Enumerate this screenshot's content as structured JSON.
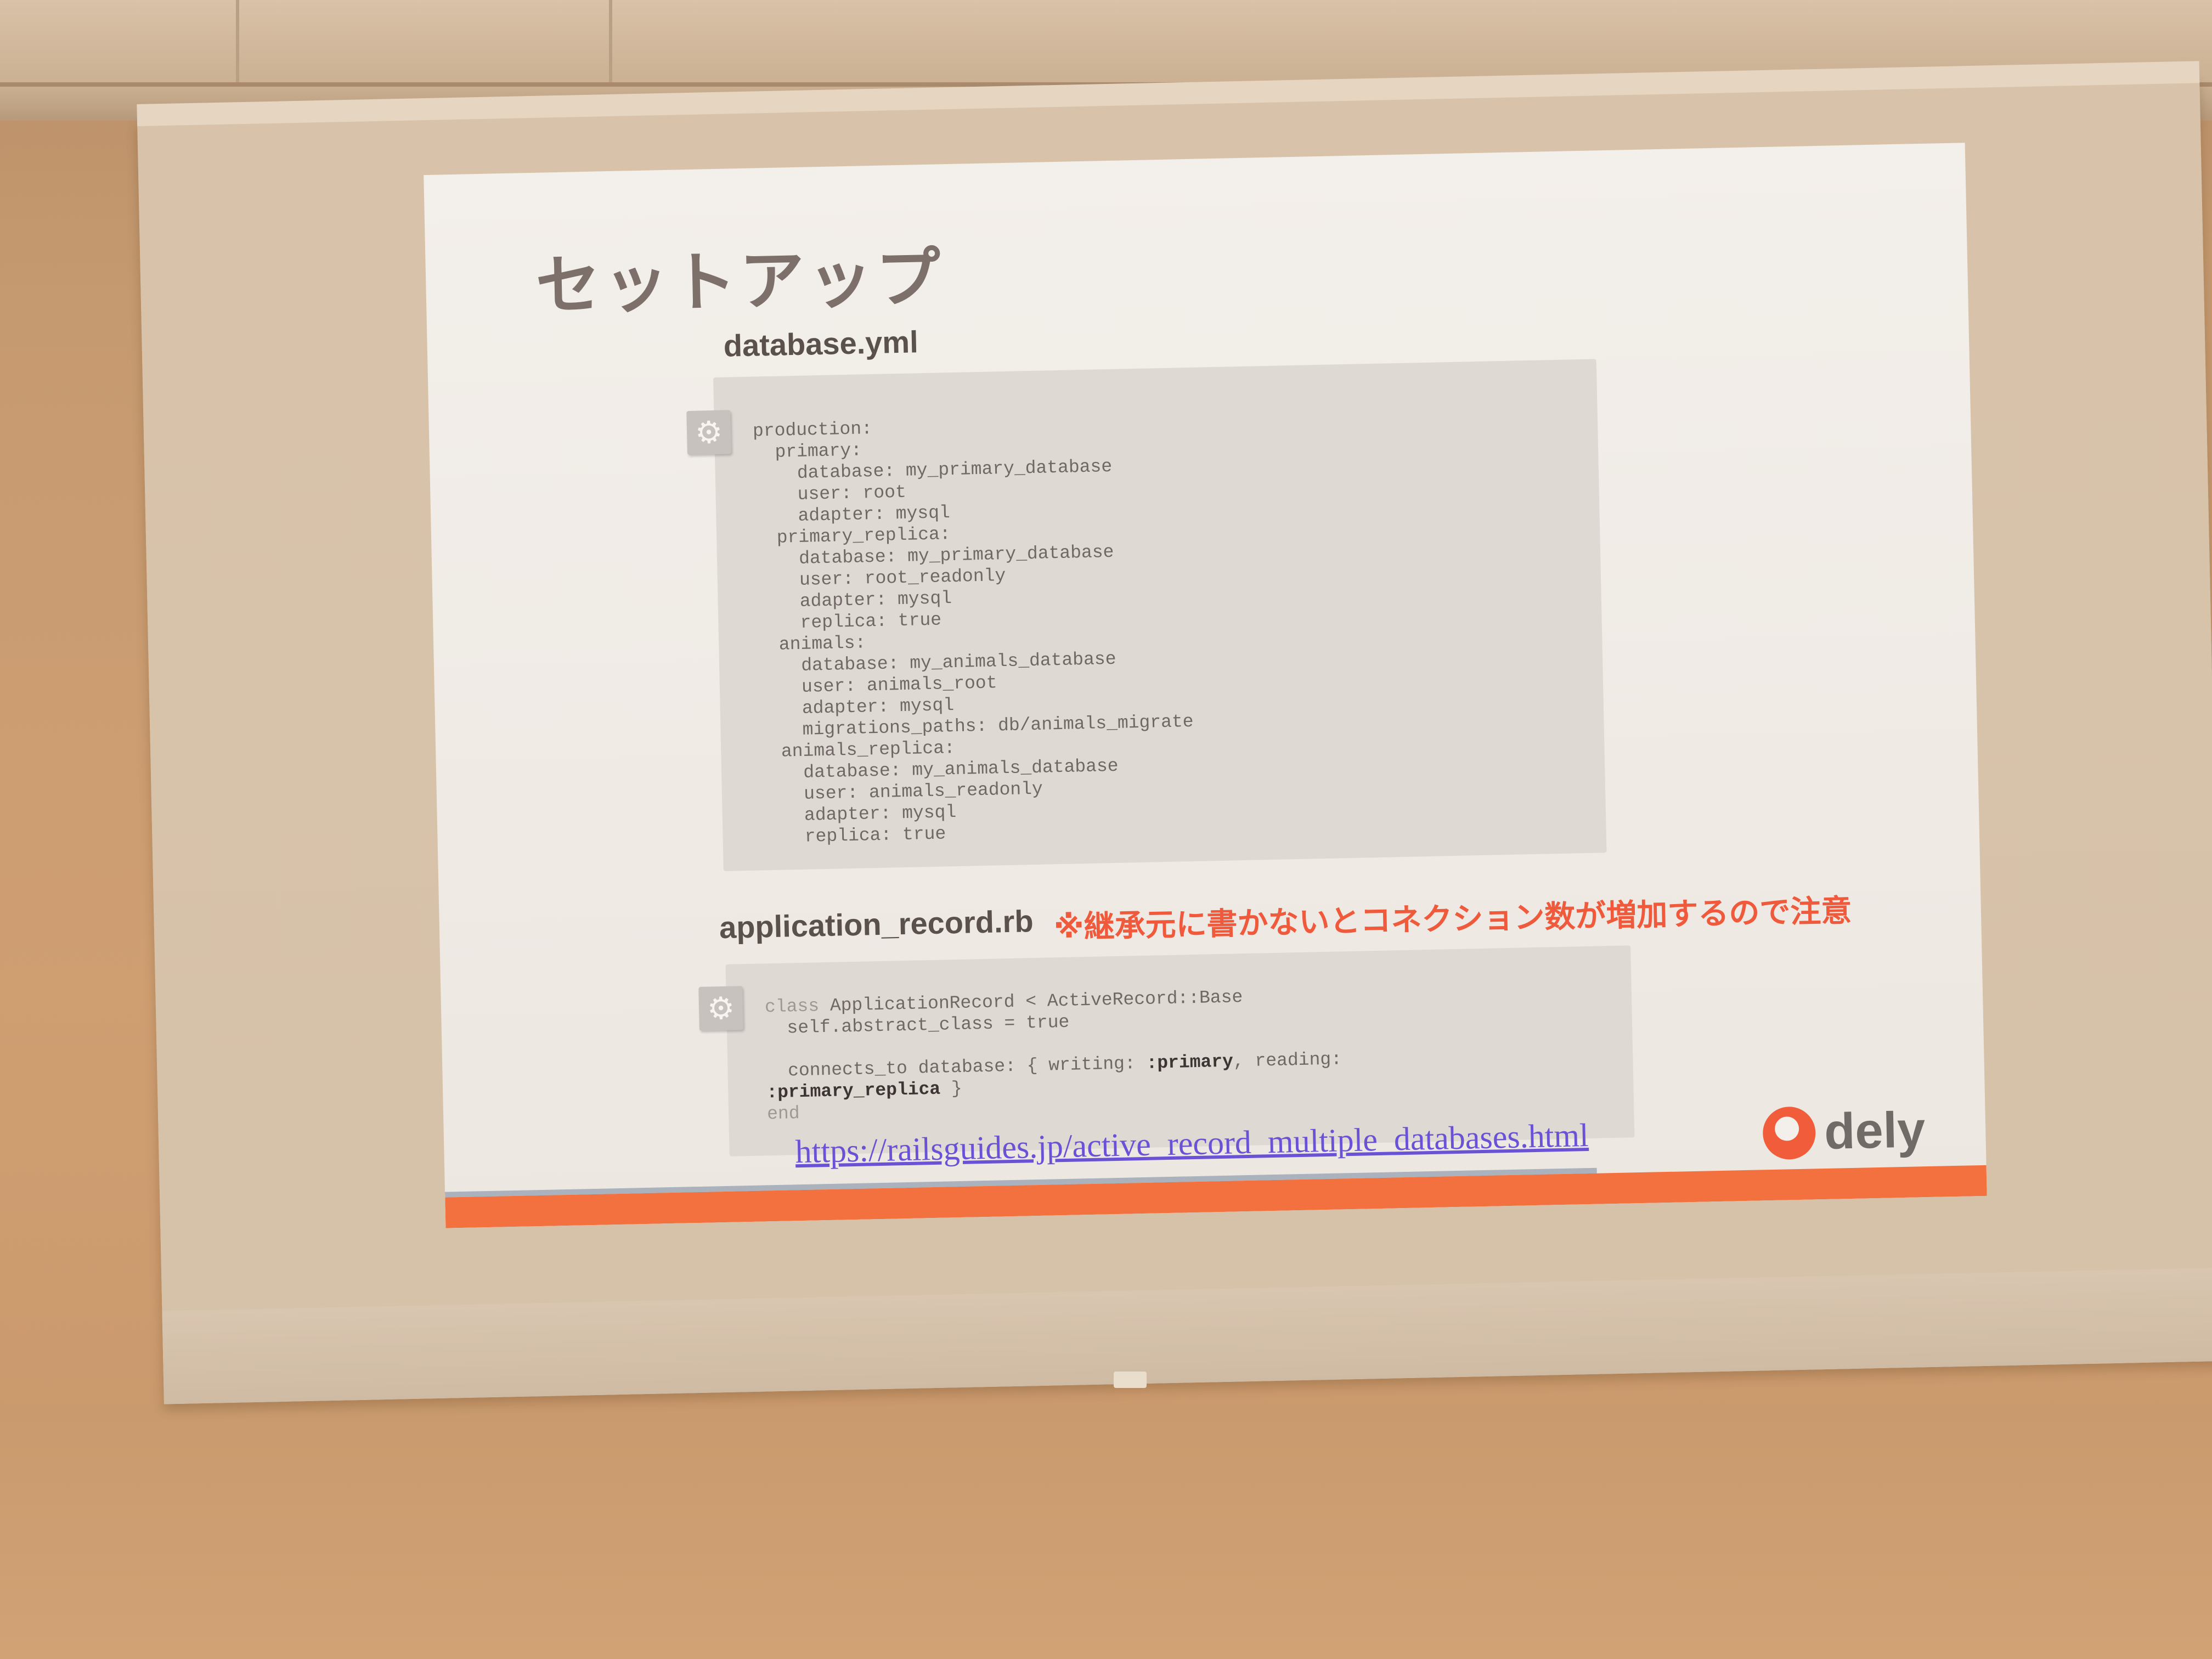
{
  "slide": {
    "title": "セットアップ",
    "db_file_label": "database.yml",
    "db_code": "production:\n  primary:\n    database: my_primary_database\n    user: root\n    adapter: mysql\n  primary_replica:\n    database: my_primary_database\n    user: root_readonly\n    adapter: mysql\n    replica: true\n  animals:\n    database: my_animals_database\n    user: animals_root\n    adapter: mysql\n    migrations_paths: db/animals_migrate\n  animals_replica:\n    database: my_animals_database\n    user: animals_readonly\n    adapter: mysql\n    replica: true",
    "app_file_label": "application_record.rb",
    "warning_note": "※継承元に書かないとコネクション数が増加するので注意",
    "app_code": {
      "line1_kw": "class",
      "line1_rest": " ApplicationRecord < ActiveRecord::Base",
      "line2": "  self.abstract_class = true",
      "line3_prefix": "  connects_to database: { writing: ",
      "line3_primary": ":primary",
      "line3_suffix": ", reading:",
      "line4_primary_replica": ":primary_replica",
      "line4_suffix": " }",
      "line5_kw": "end"
    },
    "link": "https://railsguides.jp/active_record_multiple_databases.html",
    "logo_text": "dely"
  },
  "colors": {
    "accent_orange": "#f2713f",
    "warning_red": "#f05a3c",
    "link_purple": "#6a52d6"
  },
  "icons": {
    "code_badge": "gear-icon",
    "logo": "dely-logo-icon"
  }
}
